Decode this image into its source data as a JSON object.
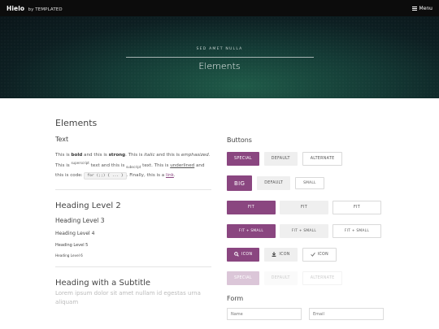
{
  "header": {
    "brand_main": "Hielo",
    "brand_sub": "by TEMPLATED",
    "menu_label": "Menu",
    "menu_icon": "hamburger-icon"
  },
  "banner": {
    "subtitle": "SED AMET NULLA",
    "title": "Elements"
  },
  "left": {
    "section_title": "Elements",
    "text_heading": "Text",
    "para": {
      "t1": "This is ",
      "bold": "bold",
      "t2": " and this is ",
      "strong": "strong",
      "t3": ". This is ",
      "italic": "italic",
      "t4": " and this is ",
      "emphasized": "emphasized",
      "t5": ". This is ",
      "superscript": "superscript",
      "t6": " text and this is ",
      "subscript": "subscript",
      "t7": " text. This is ",
      "underlined": "underlined",
      "t8": " and this is code: ",
      "code": "for (;;) { ... }",
      "t9": ". Finally, this is a ",
      "link": "link",
      "t10": "."
    },
    "h2": "Heading Level 2",
    "h3": "Heading Level 3",
    "h4": "Heading Level 4",
    "h5": "Heading Level 5",
    "h6": "Heading Level 6",
    "subtitle_heading": "Heading with a Subtitle",
    "subtitle_text": "Lorem ipsum dolor sit amet nullam id egestas urna aliquam"
  },
  "right": {
    "buttons_heading": "Buttons",
    "row1": [
      "SPECIAL",
      "DEFAULT",
      "ALTERNATE"
    ],
    "row2": [
      "BIG",
      "DEFAULT",
      "SMALL"
    ],
    "row3": [
      "FIT",
      "FIT",
      "FIT"
    ],
    "row4": [
      "FIT + SMALL",
      "FIT + SMALL",
      "FIT + SMALL"
    ],
    "row5": [
      {
        "label": "ICON",
        "icon": "search-icon"
      },
      {
        "label": "ICON",
        "icon": "download-icon"
      },
      {
        "label": "ICON",
        "icon": "check-icon"
      }
    ],
    "row6": [
      "SPECIAL",
      "DEFAULT",
      "ALTERNATE"
    ],
    "form_heading": "Form",
    "name_placeholder": "Name",
    "email_placeholder": "Email"
  },
  "colors": {
    "accent": "#8a4680",
    "topbar": "#0c0c0c"
  }
}
